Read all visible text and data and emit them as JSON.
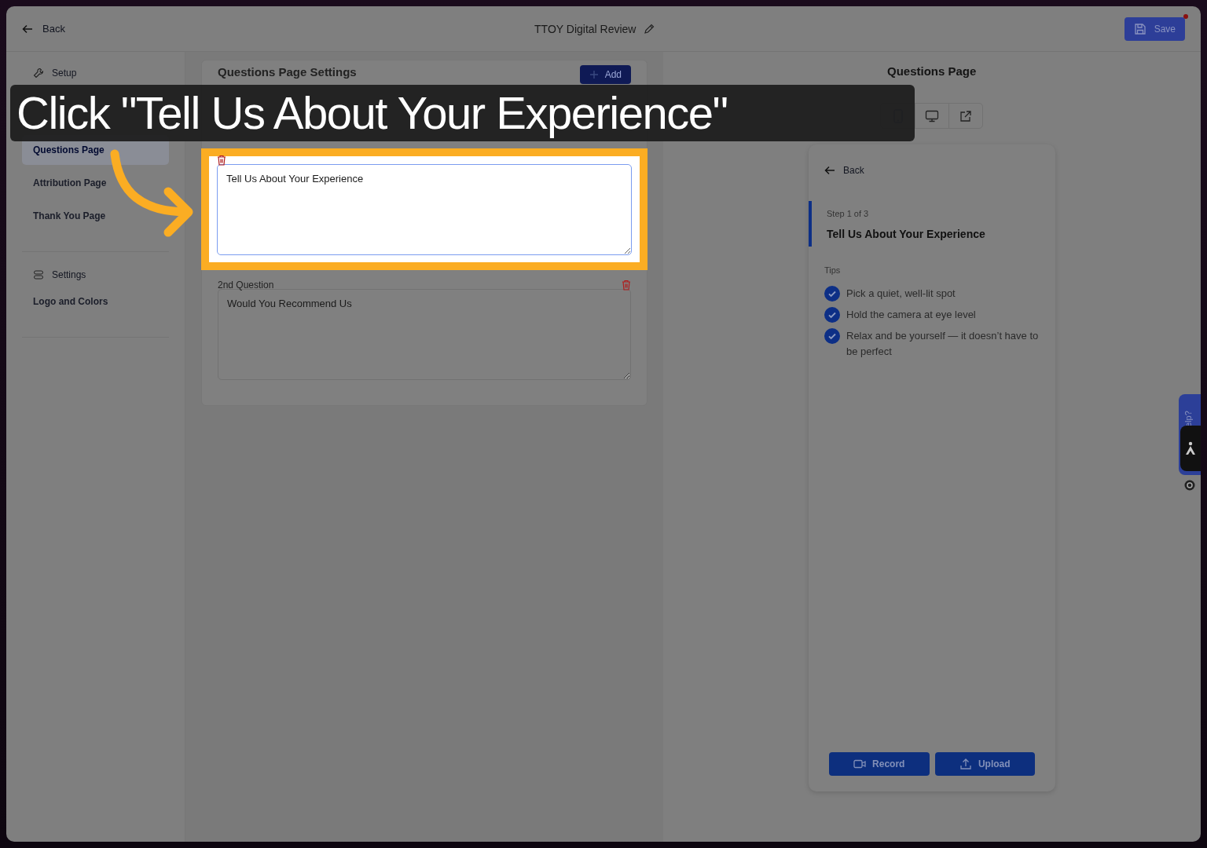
{
  "tutorial": {
    "caption": "Click \"Tell Us About Your Experience\""
  },
  "top_bar": {
    "back": "Back",
    "title": "TTOY Digital Review",
    "save": "Save",
    "unsaved": true
  },
  "sidebar": {
    "sections": [
      {
        "heading": "Setup",
        "items": [
          {
            "label": "Questions Page",
            "selected": true
          },
          {
            "label": "Attribution Page",
            "selected": false
          },
          {
            "label": "Thank You Page",
            "selected": false
          }
        ]
      },
      {
        "heading": "Settings",
        "items": [
          {
            "label": "Logo and Colors",
            "selected": false
          }
        ]
      }
    ]
  },
  "editor": {
    "title": "Questions Page Settings",
    "add_button": "Add",
    "questions": [
      {
        "value": "Tell Us About Your Experience",
        "highlighted": true
      },
      {
        "label": "2nd Question",
        "value": "Would You Recommend Us",
        "highlighted": false
      }
    ]
  },
  "preview": {
    "title": "Questions Page",
    "views": [
      {
        "kind": "mobile"
      },
      {
        "kind": "desktop"
      },
      {
        "kind": "open"
      }
    ],
    "back": "Back",
    "step": "Step 1 of 3",
    "question": "Tell Us About Your Experience",
    "tips_heading": "Tips",
    "tips": [
      "Pick a quiet, well-lit spot",
      "Hold the camera at eye level",
      "Relax and be yourself — it doesn’t have to be perfect"
    ],
    "buttons": [
      {
        "kind": "record",
        "label": "Record"
      },
      {
        "kind": "upload",
        "label": "Upload"
      }
    ]
  },
  "help": {
    "label": "elp?"
  }
}
